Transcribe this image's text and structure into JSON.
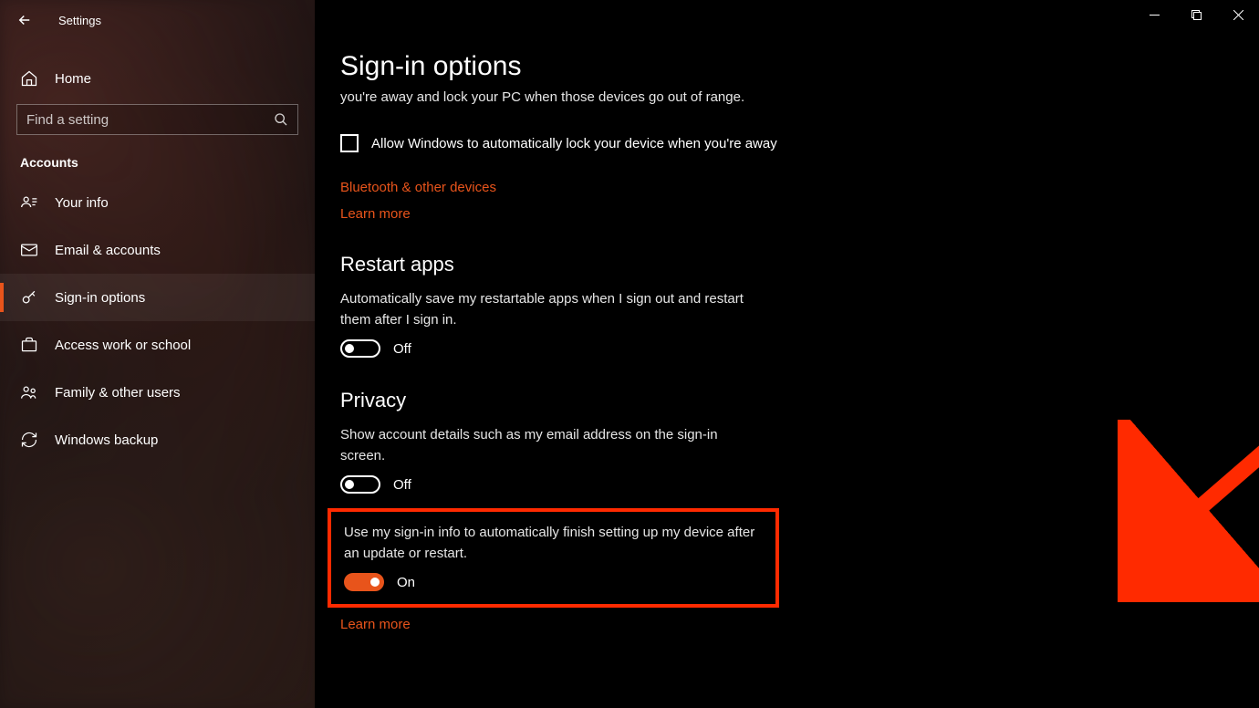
{
  "window": {
    "title": "Settings"
  },
  "sidebar": {
    "home_label": "Home",
    "search_placeholder": "Find a setting",
    "category": "Accounts",
    "items": [
      {
        "label": "Your info"
      },
      {
        "label": "Email & accounts"
      },
      {
        "label": "Sign-in options"
      },
      {
        "label": "Access work or school"
      },
      {
        "label": "Family & other users"
      },
      {
        "label": "Windows backup"
      }
    ]
  },
  "main": {
    "page_title": "Sign-in options",
    "lockscreen_fragment": "you're away and lock your PC when those devices go out of range.",
    "checkbox_label": "Allow Windows to automatically lock your device when you're away",
    "link_bluetooth": "Bluetooth & other devices",
    "link_learn_more_1": "Learn more",
    "restart_heading": "Restart apps",
    "restart_desc": "Automatically save my restartable apps when I sign out and restart them after I sign in.",
    "restart_toggle_label": "Off",
    "privacy_heading": "Privacy",
    "privacy_desc_1": "Show account details such as my email address on the sign-in screen.",
    "privacy_toggle1_label": "Off",
    "privacy_desc_2": "Use my sign-in info to automatically finish setting up my device after an update or restart.",
    "privacy_toggle2_label": "On",
    "link_learn_more_2": "Learn more"
  }
}
